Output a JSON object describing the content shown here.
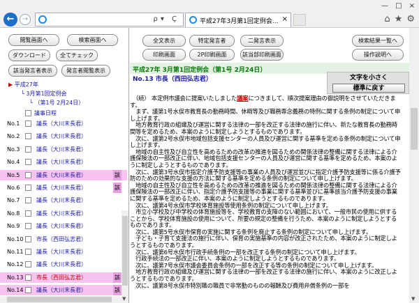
{
  "browser": {
    "tab_title": "平成27年3月第1回定例会...",
    "back": "←",
    "forward": "→",
    "addr_tools": "ρ▾ Ç",
    "tab_close": "×",
    "window_controls": [
      "—",
      "□",
      "×"
    ],
    "right_icons": [
      "⌂",
      "★",
      "⚙"
    ]
  },
  "left": {
    "buttons": {
      "view_screen": "閲覧画面へ",
      "search_screen": "検索画面へ",
      "download": "ダウンロード",
      "check_all": "全てチェック",
      "show_speaker": "該当発言者表示",
      "speech_filter": "発言者閲覧表示"
    },
    "tree": {
      "year": "平成27年",
      "session": "3月第1回定例会",
      "day": "（第1号 2月24日）",
      "agenda": "議事日程"
    },
    "rows": [
      {
        "no": "No.1",
        "speaker": "議長（大川末長君）",
        "hl": false
      },
      {
        "no": "No.2",
        "speaker": "議長（大川末長君）",
        "hl": false
      },
      {
        "no": "No.3",
        "speaker": "議長（大川末長君）",
        "hl": false
      },
      {
        "no": "No.4",
        "speaker": "議長（大川末長君）",
        "hl": false
      },
      {
        "no": "No.5",
        "speaker": "議長（大川末長君）",
        "hl": true,
        "tag": "該"
      },
      {
        "no": "No.6",
        "speaker": "議長（大川末長君）",
        "hl": false,
        "tag": "該"
      },
      {
        "no": "No.7",
        "speaker": "議長（大川末長君）",
        "hl": false
      },
      {
        "no": "No.8",
        "speaker": "議長（大川末長君）",
        "hl": false
      },
      {
        "no": "No.9",
        "speaker": "議長（大川末長君）",
        "hl": false
      },
      {
        "no": "No.10",
        "speaker": "市長（西田弘志君）",
        "hl": false
      },
      {
        "no": "No.11",
        "speaker": "議長（大川末長君）",
        "hl": false
      },
      {
        "no": "No.12",
        "speaker": "議長（大川末長君）",
        "hl": false
      },
      {
        "no": "No.13",
        "speaker": "市長（西田弘志君）",
        "hl": true,
        "tag": "該",
        "red": true
      },
      {
        "no": "No.14",
        "speaker": "議長（大川末長君）",
        "hl": true,
        "tag": "該"
      }
    ]
  },
  "right": {
    "buttons": {
      "show_all": "全文表示",
      "specific_speaker": "特定発言者",
      "dual_display": "二発言表示",
      "search_results": "検索結果一覧へ",
      "print_screen": "印刷画面",
      "print_2p": "2P印刷画面",
      "print_relevant": "該当部印刷画面",
      "help": "操作説明へ"
    },
    "heading": "平成27年 3月第1回定例会（第1号 2月24日）",
    "speaker": "No.13 市長（西田弘志君）",
    "text_smaller": "文字を小さく",
    "text_reset": "標準に戻す",
    "paragraphs": [
      {
        "pre": "　（続） 本定例市議会に提案いたしました",
        "kw": "議案",
        "post": "につきまして、順次提案理由の御説明をさせていただきます。"
      },
      {
        "text": "　まず、議第1号水俣市教育長の勤務時間、休暇等及び職務専念義務の特例に関する条例の制定について申し上げます。"
      },
      {
        "text": "　地方教育行政の組織及び運営に関する法律の一部を改正する法律の施行に伴い、新たな教育長の勤務時間等を定めるため、本案のように制定しようとするものであります。"
      },
      {
        "text": "　次に、議第2号水俣市地域包括支援センターの人員及び運営に関する基準を定める条例の制定について申し上げます。"
      },
      {
        "text": "　地域の自主性及び自立性を高めるための改革の推進を図るための関係法律の整備に関する法律による介護保険法の一部改正に伴い、地域包括支援センターの人員及び運営に関する基準を定めるため、本案のように制定しようとするものであります。"
      },
      {
        "text": "　次に、議第3号水俣市指定介護予防支援等の事業の人員及び運営並びに指定介護予防支援等に係る介護予防のための効果的な支援の方法に関する基準を定める条例の制定について申し上げます。"
      },
      {
        "text": "　地域の自主性及び自立性を高めるための改革の推進を図るための関係法律の整備に関する法律による介護保険法の一部改正に伴い、指定介護予防支援等の事業に関する基準並びに基準該当介護予防支援の事業に関する基準を定めるため、本案のように制定しようとするものであります。"
      },
      {
        "text": "　次に、議第4号水俣市学校体育施設等使用条例の制定について申し上げます。"
      },
      {
        "text": "　市立小学校及び中学校の体育施設等を、学校教育の支障のない範囲において、一般市民の使用に供することから、学校体育施設の使用について、所要の規定の整備を行うため、本案のように制定しようとするものであります。"
      },
      {
        "text": "　次に、議第5号水俣市保育の実施に関する条例を廃止する条例の制定について申し上げます。"
      },
      {
        "text": "　子ども・子育て支援法の施行に伴い、保育の実施基準の内容が改正されたため、本案のように制定しようとするものであります。"
      },
      {
        "text": "　次に、議第6号水俣市行政手続条例の一部を改正する条例の制定について申し上げます。"
      },
      {
        "text": "　行政手続法の一部改正に伴い、本案のように制定しようとするものであります。"
      },
      {
        "text": "　次に、議第7号水俣市議会委員会条例の一部を改正する等の条例の制定について申し上げます。"
      },
      {
        "text": "　地方教育行政の組織及び運営に関する法律の一部を改正する法律の施行に伴い、本案のように改正しようとするものであります。"
      },
      {
        "text": "　次に、議第8号水俣市特別職の職員で非常勤のものの報酬及び費用弁償条例の一部を"
      }
    ]
  },
  "colors": {
    "highlight_row": "#f7c3f0",
    "tag": "#e6a0e0",
    "heading_green": "#0a7a0a",
    "speaker_blue": "#1a1aa8",
    "keyword_red": "#d00000"
  }
}
